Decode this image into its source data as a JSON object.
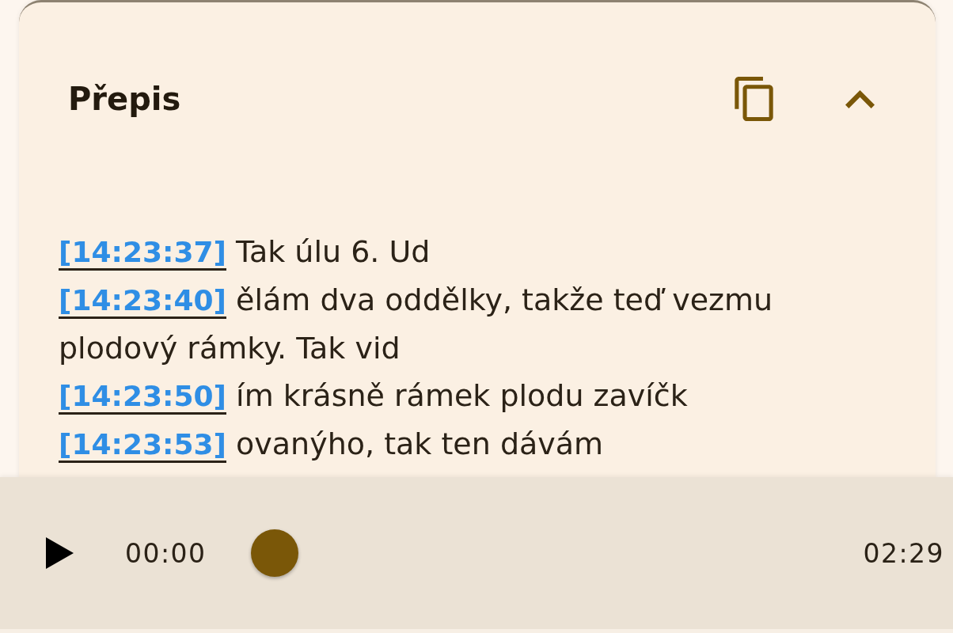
{
  "transcript_card": {
    "title": "Přepis",
    "expanded": true,
    "entries": [
      {
        "timestamp": "[14:23:37]",
        "text": "Tak úlu 6. Ud"
      },
      {
        "timestamp": "[14:23:40]",
        "text": "ělám dva oddělky, takže teď vezmu plodový rámky. Tak vid"
      },
      {
        "timestamp": "[14:23:50]",
        "text": "ím krásně rámek plodu zavíčk"
      },
      {
        "timestamp": "[14:23:53]",
        "text": "ovanýho, tak ten dávám"
      }
    ]
  },
  "player": {
    "playing": false,
    "elapsed": "00:00",
    "level": 0,
    "duration": "02:29"
  }
}
